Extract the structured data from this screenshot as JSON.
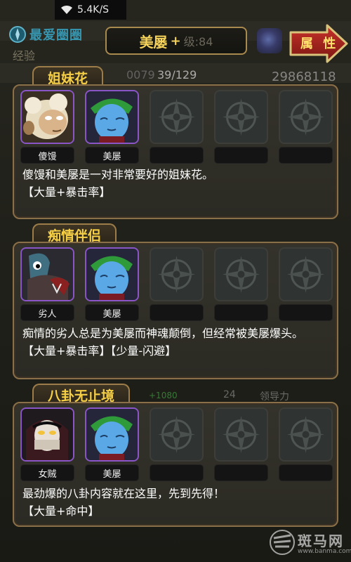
{
  "status_bar": {
    "speed": "5.4K/S"
  },
  "background": {
    "title": "最爱圈圈",
    "exp_label": "经验",
    "left_value": "0079",
    "progress": "39/129",
    "gold": "29868118",
    "stat_value": "24",
    "stat_label": "领导力",
    "green_text": "+1080"
  },
  "header": {
    "name": "美屡",
    "plus": "+",
    "level": "级:84",
    "attr_button": "属 性"
  },
  "panels": [
    {
      "title": "姐妹花",
      "members": [
        {
          "name": "傻馒",
          "portrait": "sheep-face"
        },
        {
          "name": "美屡",
          "portrait": "blue-face"
        }
      ],
      "description": "傻馒和美屡是一对非常要好的姐妹花。",
      "bonus": "【大量+暴击率】"
    },
    {
      "title": "痴情伴侣",
      "members": [
        {
          "name": "劣人",
          "portrait": "fish-knight"
        },
        {
          "name": "美屡",
          "portrait": "blue-face"
        }
      ],
      "description": "痴情的劣人总是为美屡而神魂颠倒，但经常被美屡爆头。",
      "bonus": "【大量+暴击率】【少量-闪避】"
    },
    {
      "title": "八卦无止境",
      "members": [
        {
          "name": "女贼",
          "portrait": "masked-thief"
        },
        {
          "name": "美屡",
          "portrait": "blue-face"
        }
      ],
      "description": "最劲爆的八卦内容就在这里，先到先得！",
      "bonus": "【大量+命中】"
    }
  ],
  "watermark": {
    "text": "斑马网",
    "url": "www.banma.com"
  },
  "colors": {
    "gold": "#f5cf46",
    "frame": "#8a7048",
    "epic": "#8a55c6"
  }
}
